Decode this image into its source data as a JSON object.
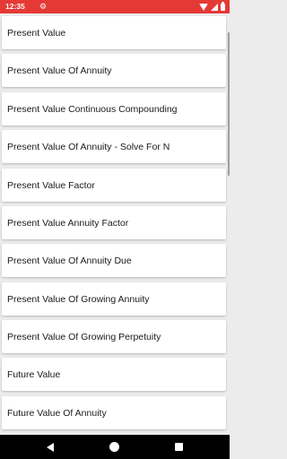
{
  "status_bar": {
    "time": "12:35",
    "settings_icon": "gear-icon",
    "icons": [
      "wifi-icon",
      "signal-icon",
      "battery-icon"
    ],
    "background": "#e53935"
  },
  "list": {
    "items": [
      "Present Value",
      "Present Value Of Annuity",
      "Present Value Continuous Compounding",
      "Present Value Of Annuity - Solve For N",
      "Present Value Factor",
      "Present Value Annuity Factor",
      "Present Value Of Annuity Due",
      "Present Value Of Growing Annuity",
      "Present Value Of Growing Perpetuity",
      "Future Value",
      "Future Value Of Annuity"
    ]
  },
  "nav_bar": {
    "buttons": [
      "back-icon",
      "home-icon",
      "recents-icon"
    ]
  }
}
